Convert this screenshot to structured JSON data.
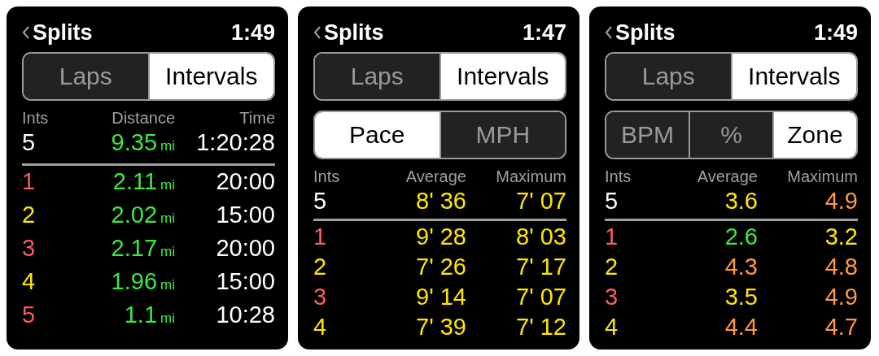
{
  "panels": [
    {
      "title": "Splits",
      "time": "1:49",
      "segment_groups": [
        [
          {
            "label": "Laps",
            "selected": false
          },
          {
            "label": "Intervals",
            "selected": true
          }
        ]
      ],
      "columns": [
        "Ints",
        "Distance",
        "Time"
      ],
      "summary": [
        {
          "text": "5",
          "color": "#ffffff"
        },
        {
          "text": "9.35",
          "unit": "mi",
          "color": "#3ee83e"
        },
        {
          "text": "1:20:28",
          "color": "#ffffff"
        }
      ],
      "rows": [
        {
          "cells": [
            {
              "text": "1",
              "color": "#fa5c5c"
            },
            {
              "text": "2.11",
              "unit": "mi",
              "color": "#3ee83e"
            },
            {
              "text": "20:00",
              "color": "#ffffff"
            }
          ]
        },
        {
          "cells": [
            {
              "text": "2",
              "color": "#ffe600"
            },
            {
              "text": "2.02",
              "unit": "mi",
              "color": "#3ee83e"
            },
            {
              "text": "15:00",
              "color": "#ffffff"
            }
          ]
        },
        {
          "cells": [
            {
              "text": "3",
              "color": "#fa5c5c"
            },
            {
              "text": "2.17",
              "unit": "mi",
              "color": "#3ee83e"
            },
            {
              "text": "20:00",
              "color": "#ffffff"
            }
          ]
        },
        {
          "cells": [
            {
              "text": "4",
              "color": "#ffe600"
            },
            {
              "text": "1.96",
              "unit": "mi",
              "color": "#3ee83e"
            },
            {
              "text": "15:00",
              "color": "#ffffff"
            }
          ]
        },
        {
          "cells": [
            {
              "text": "5",
              "color": "#fa5c5c"
            },
            {
              "text": "1.1",
              "unit": "mi",
              "color": "#3ee83e"
            },
            {
              "text": "10:28",
              "color": "#ffffff"
            }
          ]
        }
      ]
    },
    {
      "title": "Splits",
      "time": "1:47",
      "segment_groups": [
        [
          {
            "label": "Laps",
            "selected": false
          },
          {
            "label": "Intervals",
            "selected": true
          }
        ],
        [
          {
            "label": "Pace",
            "selected": true
          },
          {
            "label": "MPH",
            "selected": false
          }
        ]
      ],
      "columns": [
        "Ints",
        "Average",
        "Maximum"
      ],
      "summary": [
        {
          "text": "5",
          "color": "#ffffff"
        },
        {
          "text": "8' 36",
          "color": "#ffe600"
        },
        {
          "text": "7' 07",
          "color": "#ffe600"
        }
      ],
      "rows": [
        {
          "cells": [
            {
              "text": "1",
              "color": "#fa5c5c"
            },
            {
              "text": "9' 28",
              "color": "#ffe600"
            },
            {
              "text": "8' 03",
              "color": "#ffe600"
            }
          ]
        },
        {
          "cells": [
            {
              "text": "2",
              "color": "#ffe600"
            },
            {
              "text": "7' 26",
              "color": "#ffe600"
            },
            {
              "text": "7' 17",
              "color": "#ffe600"
            }
          ]
        },
        {
          "cells": [
            {
              "text": "3",
              "color": "#fa5c5c"
            },
            {
              "text": "9' 14",
              "color": "#ffe600"
            },
            {
              "text": "7' 07",
              "color": "#ffe600"
            }
          ]
        },
        {
          "cells": [
            {
              "text": "4",
              "color": "#ffe600"
            },
            {
              "text": "7' 39",
              "color": "#ffe600"
            },
            {
              "text": "7' 12",
              "color": "#ffe600"
            }
          ]
        }
      ]
    },
    {
      "title": "Splits",
      "time": "1:49",
      "segment_groups": [
        [
          {
            "label": "Laps",
            "selected": false
          },
          {
            "label": "Intervals",
            "selected": true
          }
        ],
        [
          {
            "label": "BPM",
            "selected": false
          },
          {
            "label": "%",
            "selected": false
          },
          {
            "label": "Zone",
            "selected": true
          }
        ]
      ],
      "columns": [
        "Ints",
        "Average",
        "Maximum"
      ],
      "summary": [
        {
          "text": "5",
          "color": "#ffffff"
        },
        {
          "text": "3.6",
          "color": "#ffe600"
        },
        {
          "text": "4.9",
          "color": "#ff9a3c"
        }
      ],
      "rows": [
        {
          "cells": [
            {
              "text": "1",
              "color": "#fa5c5c"
            },
            {
              "text": "2.6",
              "color": "#3ee83e"
            },
            {
              "text": "3.2",
              "color": "#ffe600"
            }
          ]
        },
        {
          "cells": [
            {
              "text": "2",
              "color": "#ffe600"
            },
            {
              "text": "4.3",
              "color": "#ff9a3c"
            },
            {
              "text": "4.8",
              "color": "#ff9a3c"
            }
          ]
        },
        {
          "cells": [
            {
              "text": "3",
              "color": "#fa5c5c"
            },
            {
              "text": "3.5",
              "color": "#ffe600"
            },
            {
              "text": "4.9",
              "color": "#ff9a3c"
            }
          ]
        },
        {
          "cells": [
            {
              "text": "4",
              "color": "#ffe600"
            },
            {
              "text": "4.4",
              "color": "#ff9a3c"
            },
            {
              "text": "4.7",
              "color": "#ff9a3c"
            }
          ]
        }
      ]
    }
  ]
}
